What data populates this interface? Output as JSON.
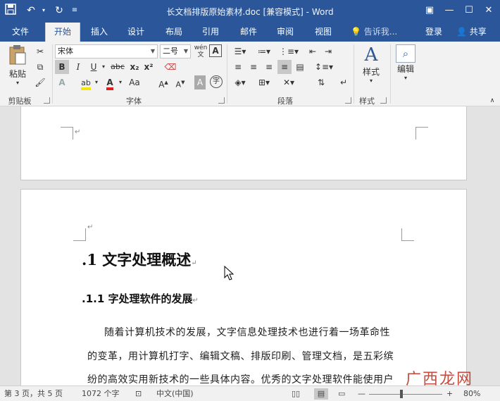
{
  "titlebar": {
    "title": "长文档排版原始素材.doc [兼容模式] - Word",
    "qat": [
      "save-icon",
      "undo-icon",
      "redo-icon",
      "customize-icon"
    ]
  },
  "tabs": [
    {
      "label": "文件"
    },
    {
      "label": "开始"
    },
    {
      "label": "插入"
    },
    {
      "label": "设计"
    },
    {
      "label": "布局"
    },
    {
      "label": "引用"
    },
    {
      "label": "邮件"
    },
    {
      "label": "审阅"
    },
    {
      "label": "视图"
    }
  ],
  "tell_me": "告诉我...",
  "login": "登录",
  "share": "共享",
  "ribbon": {
    "clipboard": {
      "paste": "粘贴",
      "label": "剪贴板"
    },
    "font": {
      "name": "宋体",
      "size": "二号",
      "label": "字体",
      "bold": "B",
      "italic": "I",
      "underline": "U",
      "strike": "abc",
      "sub": "x₂",
      "sup": "x²"
    },
    "paragraph": {
      "label": "段落"
    },
    "styles": {
      "button": "样式",
      "label": "样式"
    },
    "editing": {
      "button": "编辑"
    }
  },
  "document": {
    "heading1": "1 文字处理概述",
    "heading2": "1.1  字处理软件的发展",
    "para_lines": [
      "随着计算机技术的发展，文字信息处理技术也进行着一场革命性",
      "的变革，用计算机打字、编辑文稿、排版印刷、管理文档，是五彩缤",
      "纷的高效实用新技术的一些具体内容。优秀的文字处理软件能使用户"
    ]
  },
  "statusbar": {
    "page": "第 3 页，共 5 页",
    "words": "1072 个字",
    "language": "中文(中国)",
    "zoom": "80%"
  },
  "watermark": "广西龙网"
}
